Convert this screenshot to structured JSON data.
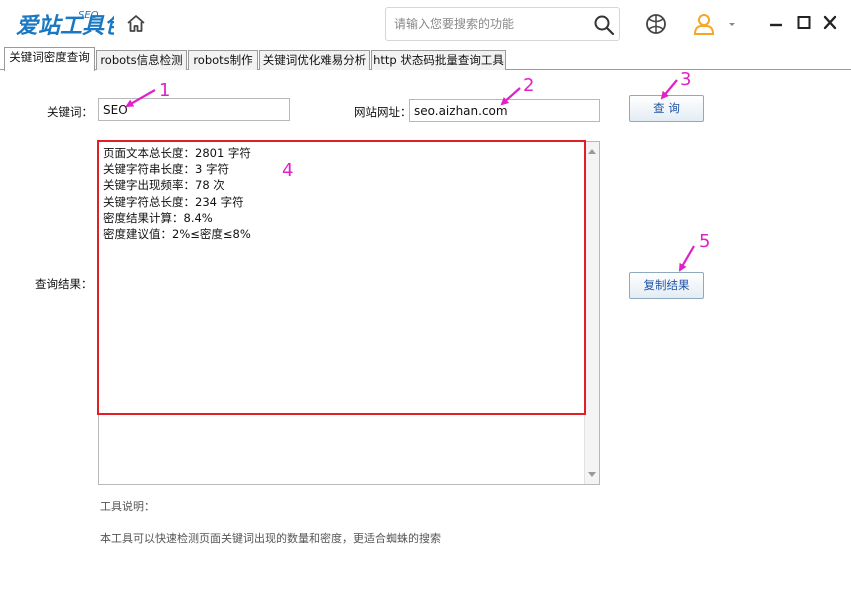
{
  "app": {
    "logo_text": "爱站工具包",
    "logo_badge": "SEO",
    "colors": {
      "brand_blue": "#1a78c2",
      "highlight_red": "#e41e26",
      "annotation_magenta": "#e020c8",
      "avatar_orange": "#f5a623"
    }
  },
  "header": {
    "search_placeholder": "请输入您要搜索的功能",
    "icons": [
      "home-icon",
      "search-icon",
      "basketball-icon",
      "user-avatar-icon",
      "chevron-down-icon",
      "minimize-icon",
      "maximize-icon",
      "close-icon"
    ]
  },
  "tabs": [
    {
      "label": "关键词密度查询",
      "active": true
    },
    {
      "label": "robots信息检测",
      "active": false
    },
    {
      "label": "robots制作",
      "active": false
    },
    {
      "label": "关键词优化难易分析",
      "active": false
    },
    {
      "label": "http 状态码批量查询工具",
      "active": false
    }
  ],
  "form": {
    "keyword_label": "关键词：",
    "keyword_value": "SEO",
    "site_label": "网站网址：",
    "site_value": "seo.aizhan.com",
    "query_button": "查 询",
    "result_label": "查询结果：",
    "copy_button": "复制结果"
  },
  "results": {
    "line1": "页面文本总长度：2801 字符",
    "line2": "关键字符串长度：3 字符",
    "line3": "关键字出现频率：78 次",
    "line4": "关键字符总长度：234 字符",
    "line5": "密度结果计算：8.4%",
    "line6": "密度建议值：2%≤密度≤8%"
  },
  "description": {
    "title": "工具说明：",
    "body": "本工具可以快速检测页面关键词出现的数量和密度，更适合蜘蛛的搜索"
  },
  "annotations": {
    "n1": "1",
    "n2": "2",
    "n3": "3",
    "n4": "4",
    "n5": "5"
  }
}
